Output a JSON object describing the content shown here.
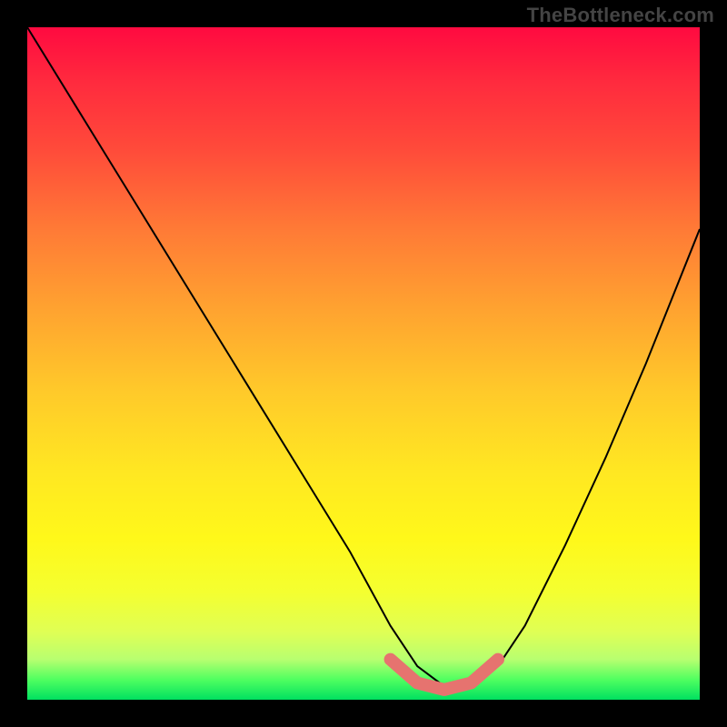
{
  "attribution": "TheBottleneck.com",
  "chart_data": {
    "type": "line",
    "title": "",
    "xlabel": "",
    "ylabel": "",
    "xlim": [
      0,
      100
    ],
    "ylim": [
      0,
      100
    ],
    "grid": false,
    "legend": false,
    "series": [
      {
        "name": "bottleneck-curve",
        "x": [
          0,
          8,
          16,
          24,
          32,
          40,
          48,
          54,
          58,
          62,
          66,
          70,
          74,
          80,
          86,
          92,
          100
        ],
        "values": [
          100,
          87,
          74,
          61,
          48,
          35,
          22,
          11,
          5,
          2,
          2,
          5,
          11,
          23,
          36,
          50,
          70
        ]
      }
    ],
    "overlay": {
      "name": "highlight-band",
      "color": "#e6736f",
      "x": [
        54,
        58,
        62,
        66,
        70
      ],
      "values": [
        6,
        2.5,
        1.5,
        2.5,
        6
      ]
    },
    "background_gradient": {
      "top": "#ff0a40",
      "mid": "#ffe722",
      "bottom": "#00e060"
    }
  }
}
